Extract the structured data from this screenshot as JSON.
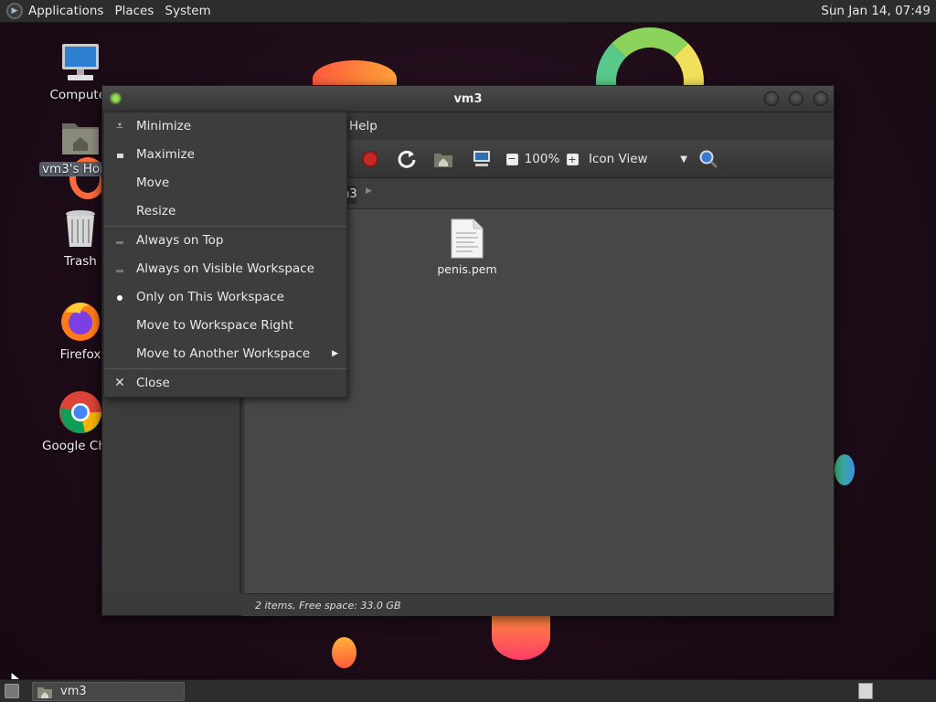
{
  "top_panel": {
    "menus": [
      "Applications",
      "Places",
      "System"
    ],
    "clock": "Sun Jan 14, 07:49"
  },
  "desktop_icons": {
    "computer": "Computer",
    "home": "vm3's Home",
    "trash": "Trash",
    "firefox": "Firefox",
    "chrome": "Google Chrome"
  },
  "window": {
    "title": "vm3",
    "menu_help": "Help",
    "toolbar": {
      "zoom": "100%",
      "view_mode": "Icon View"
    },
    "path_button": "vm3",
    "files": [
      {
        "name": "penis.pem",
        "icon": "text-file-icon"
      }
    ],
    "status": "2 items, Free space: 33.0 GB"
  },
  "context_menu": {
    "items": [
      {
        "label": "Minimize",
        "icon": "minimize-icon"
      },
      {
        "label": "Maximize",
        "icon": "maximize-icon"
      },
      {
        "label": "Move"
      },
      {
        "label": "Resize"
      },
      {
        "label": "Always on Top",
        "icon": "unchecked-toggle"
      },
      {
        "label": "Always on Visible Workspace",
        "icon": "unchecked-toggle"
      },
      {
        "label": "Only on This Workspace",
        "icon": "radio-selected"
      },
      {
        "label": "Move to Workspace Right"
      },
      {
        "label": "Move to Another Workspace",
        "icon": "submenu-arrow"
      },
      {
        "label": "Close",
        "icon": "close-icon"
      }
    ]
  },
  "taskbar": {
    "task_label": "vm3"
  },
  "colors": {
    "panel": "#2d2d2d",
    "window_bg": "#3a3a3a",
    "content_bg": "#474747",
    "stop_red": "#c62828",
    "desktop": "#1d0c18"
  }
}
